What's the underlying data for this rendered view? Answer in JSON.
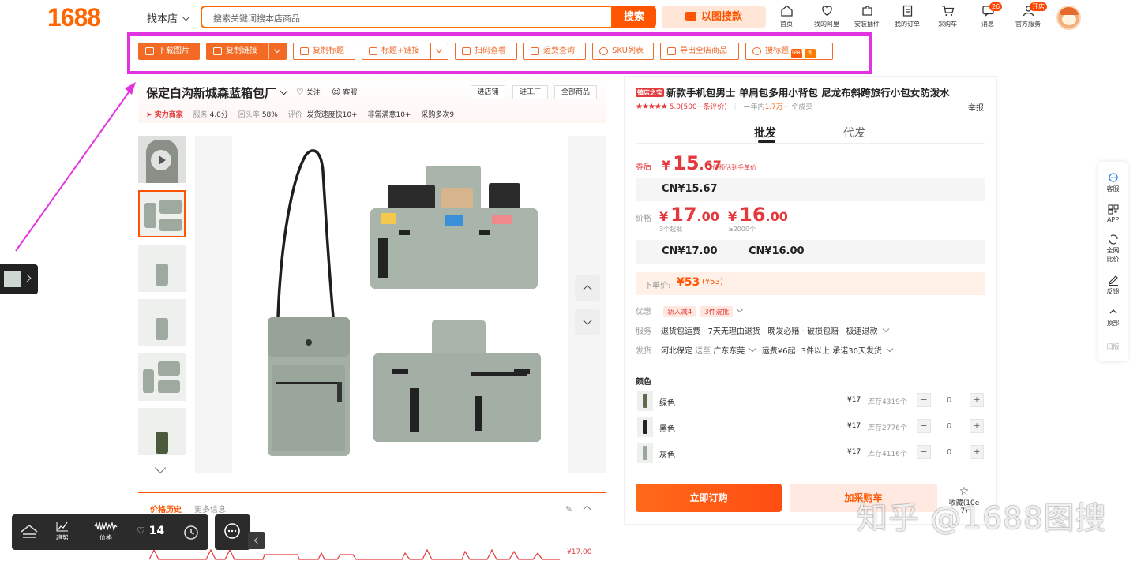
{
  "header": {
    "logo": "1688",
    "store_select": "找本店",
    "search_placeholder": "搜索关键词搜本店商品",
    "search_button": "搜索",
    "image_search": "以图搜款",
    "nav": [
      {
        "label": "首页",
        "icon": "home-icon"
      },
      {
        "label": "我的阿里",
        "icon": "heart-icon"
      },
      {
        "label": "安装插件",
        "icon": "puzzle-icon"
      },
      {
        "label": "我的订单",
        "icon": "order-icon"
      },
      {
        "label": "采购车",
        "icon": "cart-icon"
      },
      {
        "label": "消息",
        "icon": "message-icon",
        "badge": "26"
      },
      {
        "label": "官方服务",
        "icon": "service-icon",
        "badge": "开店"
      }
    ]
  },
  "toolbar": {
    "download_images": "下载图片",
    "copy_link": "复制链接",
    "copy_title": "复制标题",
    "title_link": "标题+链接",
    "scan_code": "扫码查看",
    "shipping_query": "运费查询",
    "sku_list": "SKU列表",
    "export_store": "导出全店商品",
    "search_title": "搜标题",
    "tag_1688": "1688",
    "tag_tb": "淘"
  },
  "shop": {
    "name": "保定白沟新城森蓝箱包厂",
    "follow": "关注",
    "service": "客服",
    "enter_store": "进店铺",
    "enter_factory": "进工厂",
    "all_products": "全部商品",
    "badge": "实力商家",
    "service_label": "服务",
    "service_score": "4.0分",
    "return_label": "回头率",
    "return_rate": "58%",
    "eval_label": "评价",
    "tags": [
      "发货速度快10+",
      "非常满意10+",
      "采购多次9"
    ]
  },
  "product": {
    "tag": "镇店之宝",
    "title": "新款手机包男士 单肩包多用小背包 尼龙布斜跨旅行小包女防泼水",
    "stars": "★★★★★",
    "rating": "5.0(500+条评价)",
    "sold_prefix": "一年内",
    "sold_num": "1.7万+",
    "sold_suffix": "个成交",
    "report": "举报",
    "tab_wholesale": "批发",
    "tab_dropship": "代发",
    "coupon_label": "券后",
    "coupon_currency": "¥",
    "coupon_int": "15",
    "coupon_dec": ".67",
    "coupon_note": "3件预估到手单价",
    "cn_coupon": "CN¥15.67",
    "price_label": "价格",
    "price1_int": "17",
    "price1_dec": ".00",
    "price1_note": "3个起批",
    "price2_int": "16",
    "price2_dec": ".00",
    "price2_note": "≥2000个",
    "cn_price1": "CN¥17.00",
    "cn_price2": "CN¥16.00",
    "order_label": "下单价:",
    "order_price": "¥53",
    "order_price_paren": "(¥53)",
    "discount_label": "优惠",
    "discounts": [
      "新人减4",
      "3件混批"
    ],
    "service_label": "服务",
    "services": "退货包运费 · 7天无理由退货 · 晚发必赔 · 破损包赔 · 极速退款",
    "ship_label": "发货",
    "ship_from": "河北保定",
    "ship_to_word": "送至",
    "ship_to": "广东东莞",
    "ship_fee": "运费¥6起",
    "ship_promise": "3件以上  承诺30天发货",
    "color_label": "颜色",
    "skus": [
      {
        "name": "绿色",
        "price": "¥17",
        "stock": "库存4319个",
        "qty": "0",
        "color": "#5d6a4f"
      },
      {
        "name": "黑色",
        "price": "¥17",
        "stock": "库存2776个",
        "qty": "0",
        "color": "#222222"
      },
      {
        "name": "灰色",
        "price": "¥17",
        "stock": "库存4116个",
        "qty": "0",
        "color": "#9aa79b"
      }
    ],
    "buy_now": "立即订购",
    "add_cart": "加采购车",
    "favorite": "收藏(10e 7)"
  },
  "price_history": {
    "tab1": "价格历史",
    "tab2": "更多信息",
    "value": "¥17.00"
  },
  "bottom_bar": {
    "trend": "趋势",
    "price": "价格",
    "likes": "14"
  },
  "right_bar": [
    {
      "label": "客服",
      "icon": "chat-icon"
    },
    {
      "label": "APP",
      "icon": "qr-icon"
    },
    {
      "label": "全网比价",
      "icon": "compare-icon"
    },
    {
      "label": "反馈",
      "icon": "edit-icon"
    },
    {
      "label": "顶部",
      "icon": "top-icon"
    },
    {
      "label": "旧版",
      "icon": ""
    }
  ],
  "watermark": "知乎 @1688图搜",
  "colors": {
    "accent": "#ff5500",
    "price": "#e4393c",
    "highlight": "#e233e0"
  }
}
